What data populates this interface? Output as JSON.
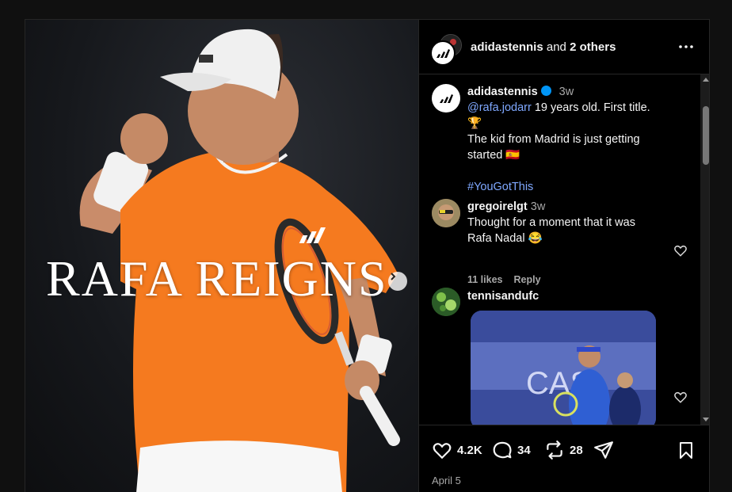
{
  "photo": {
    "caption": "RAFA REIGNS",
    "next_icon": "chevron-right-icon"
  },
  "header": {
    "account": "adidastennis",
    "and_text": " and ",
    "others": "2 others",
    "more_icon": "more-horizontal-icon"
  },
  "post": {
    "author": "adidastennis",
    "time": "3w",
    "mention": "@rafa.jodarr",
    "caption_line1": " 19 years old. First title. 🏆",
    "caption_line2": "The kid from Madrid is just getting",
    "caption_line3": "started 🇪🇸",
    "hashtag": "#YouGotThis"
  },
  "comments": [
    {
      "author": "gregoirelgt",
      "time": "3w",
      "text_line1": "Thought for a moment that it was",
      "text_line2": "Rafa Nadal 😂",
      "likes": "11 likes",
      "reply": "Reply"
    },
    {
      "author": "tennisandufc",
      "media_text": "CASI"
    }
  ],
  "actions": {
    "likes": "4.2K",
    "comments": "34",
    "reposts": "28"
  },
  "date": "April 5",
  "colors": {
    "background": "#000000",
    "link": "#7fa8ff",
    "muted": "#a8a8a8",
    "verified": "#0095f6",
    "shirt": "#f57a1f"
  }
}
